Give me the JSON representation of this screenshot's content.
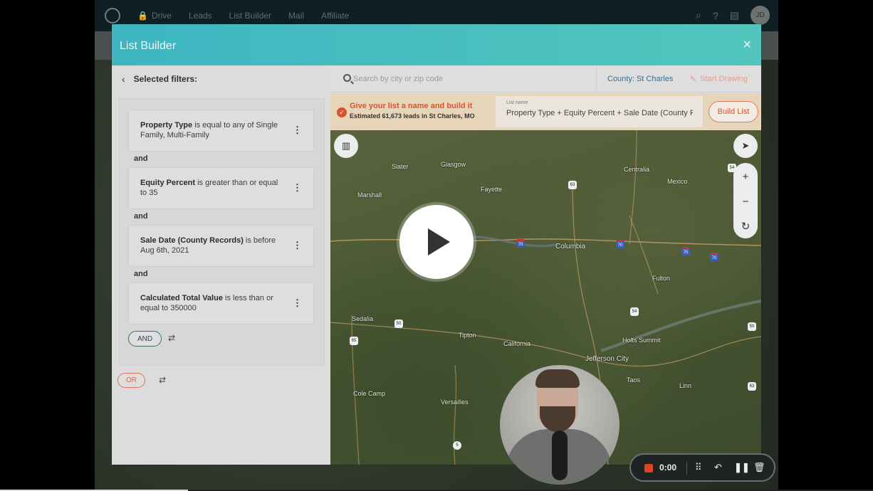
{
  "nav": {
    "items": [
      "Drive",
      "Leads",
      "List Builder",
      "Mail",
      "Affiliate"
    ],
    "avatar": "JD"
  },
  "modal": {
    "title": "List Builder",
    "close": "×"
  },
  "filters": {
    "header": "Selected filters:",
    "items": [
      {
        "field": "Property Type",
        "rest": " is equal to any of Single Family, Multi-Family"
      },
      {
        "field": "Equity Percent",
        "rest": " is greater than or equal to 35"
      },
      {
        "field": "Sale Date (County Records)",
        "rest": " is before Aug 6th, 2021"
      },
      {
        "field": "Calculated Total Value",
        "rest": " is less than or equal to 350000"
      }
    ],
    "connector": "and",
    "and_button": "AND",
    "or_button": "OR"
  },
  "search": {
    "placeholder": "Search by city or zip code",
    "county": "County: St Charles",
    "draw": "Start Drawing"
  },
  "build": {
    "title": "Give your list a name and build it",
    "estimate": "Estimated 61,673 leads in St Charles, MO",
    "name_label": "List name",
    "name_value": "Property Type + Equity Percent + Sale Date (County R",
    "button": "Build List"
  },
  "map": {
    "places": [
      "Slater",
      "Glasgow",
      "Marshall",
      "Fayette",
      "Centralia",
      "Mexico",
      "Columbia",
      "Fulton",
      "Sedalia",
      "Tipton",
      "California",
      "Holts Summit",
      "Jefferson City",
      "Taos",
      "Linn",
      "Cole Camp",
      "Versailles"
    ],
    "shields": [
      "63",
      "54",
      "70",
      "70",
      "70",
      "70",
      "54",
      "65",
      "50",
      "63",
      "50",
      "5"
    ]
  },
  "recorder": {
    "time": "0:00",
    "progress": 0.215
  }
}
